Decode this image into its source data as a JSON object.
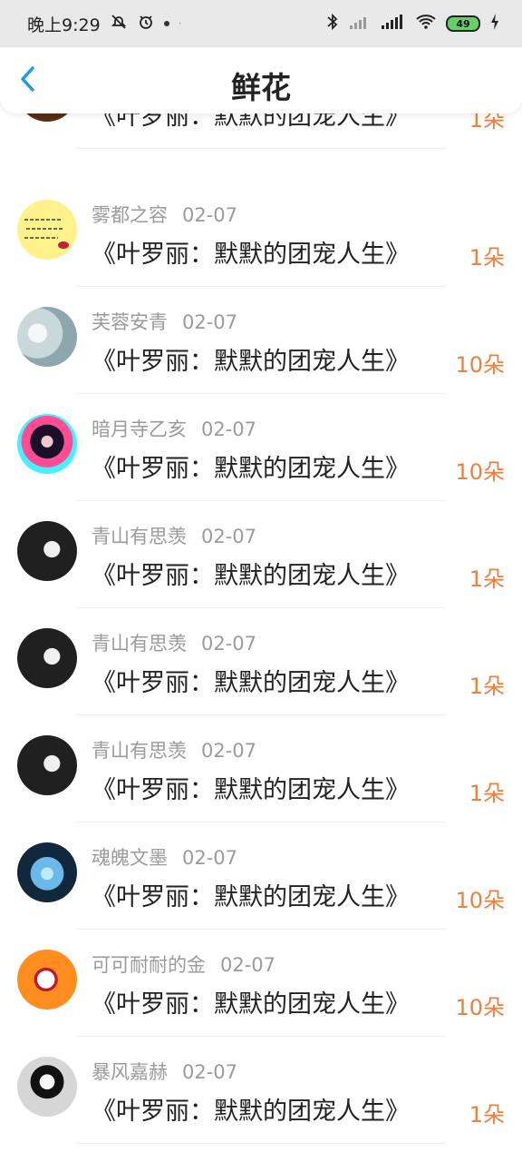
{
  "status": {
    "time": "晚上9:29",
    "battery": "49"
  },
  "header": {
    "title": "鲜花"
  },
  "items": [
    {
      "username": "",
      "date": "",
      "title": "《叶罗丽：默默的团宠人生》",
      "count": "1朵",
      "avatar_colors": [
        "#5b2c12",
        "#a46b36",
        "#e8bf74"
      ]
    },
    {
      "username": "雾都之容",
      "date": "02-07",
      "title": "《叶罗丽：默默的团宠人生》",
      "count": "1朵",
      "avatar_colors": [
        "#fff18c",
        "#ffe95d",
        "#c12035"
      ]
    },
    {
      "username": "芙蓉安青",
      "date": "02-07",
      "title": "《叶罗丽：默默的团宠人生》",
      "count": "10朵",
      "avatar_colors": [
        "#c9d8da",
        "#8da7ad",
        "#f1f4f3"
      ]
    },
    {
      "username": "暗月寺乙亥",
      "date": "02-07",
      "title": "《叶罗丽：默默的团宠人生》",
      "count": "10朵",
      "avatar_colors": [
        "#1b1029",
        "#ff4c93",
        "#46f0ff"
      ]
    },
    {
      "username": "青山有思羡",
      "date": "02-07",
      "title": "《叶罗丽：默默的团宠人生》",
      "count": "1朵",
      "avatar_colors": [
        "#202020",
        "#f0f0f0",
        "#8c8c8c"
      ]
    },
    {
      "username": "青山有思羡",
      "date": "02-07",
      "title": "《叶罗丽：默默的团宠人生》",
      "count": "1朵",
      "avatar_colors": [
        "#202020",
        "#f0f0f0",
        "#8c8c8c"
      ]
    },
    {
      "username": "青山有思羡",
      "date": "02-07",
      "title": "《叶罗丽：默默的团宠人生》",
      "count": "1朵",
      "avatar_colors": [
        "#202020",
        "#f0f0f0",
        "#8c8c8c"
      ]
    },
    {
      "username": "魂魄文墨",
      "date": "02-07",
      "title": "《叶罗丽：默默的团宠人生》",
      "count": "10朵",
      "avatar_colors": [
        "#11283c",
        "#6ab9ea",
        "#b9eaff"
      ]
    },
    {
      "username": "可可耐耐的金",
      "date": "02-07",
      "title": "《叶罗丽：默默的团宠人生》",
      "count": "10朵",
      "avatar_colors": [
        "#ff8d1f",
        "#ffffff",
        "#c0172d"
      ]
    },
    {
      "username": "暴风嘉赫",
      "date": "02-07",
      "title": "《叶罗丽：默默的团宠人生》",
      "count": "1朵",
      "avatar_colors": [
        "#d6d6d6",
        "#101010",
        "#f7f7f7"
      ]
    }
  ],
  "theme": {
    "accent": "#ef7f3d",
    "back_icon_color": "#1d9bf0",
    "muted_text": "#9b9b9b"
  }
}
